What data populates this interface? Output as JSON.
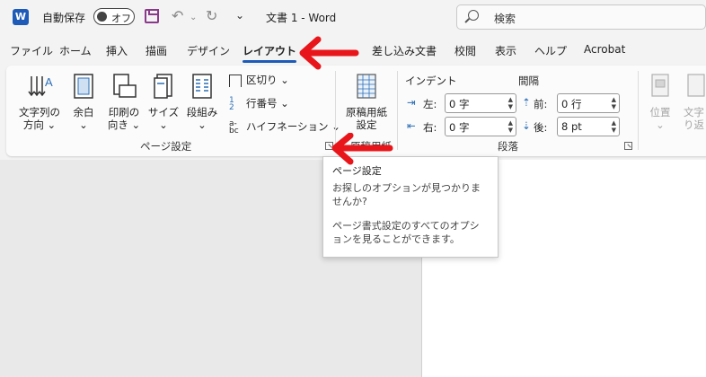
{
  "titlebar": {
    "app_icon_letter": "W",
    "autosave_label": "自動保存",
    "autosave_state": "オフ",
    "undo_glyph": "↶",
    "redo_glyph": "↻",
    "customize_glyph": "⌄",
    "document_title": "文書 1  -  Word",
    "search_placeholder": "検索"
  },
  "tabs": [
    {
      "label": "ファイル",
      "active": false
    },
    {
      "label": "ホーム",
      "active": false
    },
    {
      "label": "挿入",
      "active": false
    },
    {
      "label": "描画",
      "active": false
    },
    {
      "label": "デザイン",
      "active": false
    },
    {
      "label": "レイアウト",
      "active": true
    },
    {
      "label": "差し込み文書",
      "active": false
    },
    {
      "label": "校閲",
      "active": false
    },
    {
      "label": "表示",
      "active": false
    },
    {
      "label": "ヘルプ",
      "active": false
    },
    {
      "label": "Acrobat",
      "active": false
    }
  ],
  "ribbon": {
    "page_setup": {
      "text_direction": {
        "line1": "文字列の",
        "line2": "方向 ⌄"
      },
      "margins": {
        "line1": "余白",
        "line2": "⌄"
      },
      "orientation": {
        "line1": "印刷の",
        "line2": "向き ⌄"
      },
      "size": {
        "line1": "サイズ",
        "line2": "⌄"
      },
      "columns": {
        "line1": "段組み",
        "line2": "⌄"
      },
      "breaks": "区切り ⌄",
      "line_numbers": "行番号 ⌄",
      "hyphenation": "ハイフネーション ⌄",
      "group_label": "ページ設定"
    },
    "genko": {
      "line1": "原稿用紙",
      "line2": "設定",
      "group_label": "原稿用紙"
    },
    "paragraph": {
      "indent_header": "インデント",
      "spacing_header": "間隔",
      "left_label": "左:",
      "left_value": "0 字",
      "right_label": "右:",
      "right_value": "0 字",
      "before_label": "前:",
      "before_value": "0 行",
      "after_label": "後:",
      "after_value": "8 pt",
      "group_label": "段落"
    },
    "arrange": {
      "position_label": "位置",
      "wrap_line1": "文字",
      "wrap_line2": "り返"
    }
  },
  "tooltip": {
    "title": "ページ設定",
    "para1": "お探しのオプションが見つかりませんか?",
    "para2": "ページ書式設定のすべてのオプションを見ることができます。"
  },
  "colors": {
    "accent": "#1e5bb8",
    "annotation_arrow": "#e8161b"
  }
}
